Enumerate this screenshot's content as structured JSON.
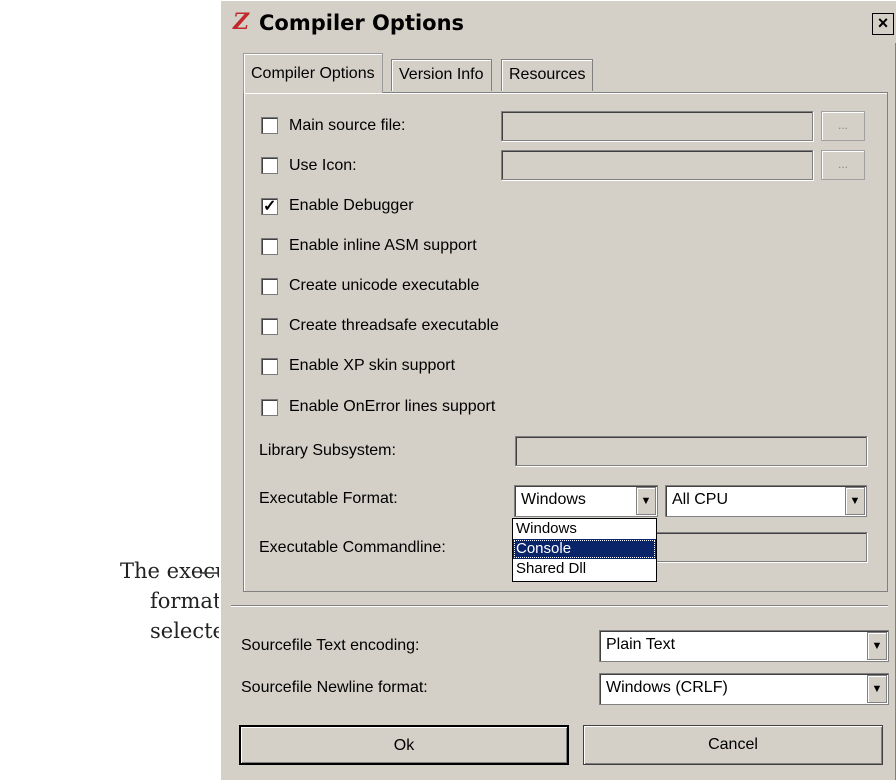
{
  "callout": {
    "lines": [
      "The executable",
      "format is",
      "selected here"
    ]
  },
  "window": {
    "title": "Compiler Options",
    "icon": "app-logo-icon",
    "close_label": "×"
  },
  "tabs": [
    {
      "label": "Compiler Options",
      "active": true
    },
    {
      "label": "Version Info",
      "active": false
    },
    {
      "label": "Resources",
      "active": false
    }
  ],
  "options": {
    "main_source": {
      "label": "Main source file:",
      "checked": false,
      "value": "",
      "browse_label": "..."
    },
    "use_icon": {
      "label": "Use Icon:",
      "checked": false,
      "value": "",
      "browse_label": "..."
    },
    "checkboxes": [
      {
        "label": "Enable Debugger",
        "checked": true
      },
      {
        "label": "Enable inline ASM support",
        "checked": false
      },
      {
        "label": "Create unicode executable",
        "checked": false
      },
      {
        "label": "Create threadsafe executable",
        "checked": false
      },
      {
        "label": "Enable XP skin support",
        "checked": false
      },
      {
        "label": "Enable OnError lines support",
        "checked": false
      }
    ],
    "library_subsystem": {
      "label": "Library Subsystem:",
      "value": ""
    },
    "executable_format": {
      "label": "Executable Format:",
      "selected": "Windows",
      "cpu_selected": "All CPU",
      "dropdown_options": [
        "Windows",
        "Console",
        "Shared Dll"
      ],
      "highlighted": "Console"
    },
    "executable_commandline": {
      "label": "Executable Commandline:",
      "value": ""
    }
  },
  "encoding": {
    "text_label": "Sourcefile Text encoding:",
    "text_value": "Plain Text",
    "newline_label": "Sourcefile Newline format:",
    "newline_value": "Windows (CRLF)"
  },
  "buttons": {
    "ok": "Ok",
    "cancel": "Cancel"
  },
  "colors": {
    "dialog_bg": "#d4d0c8",
    "selection": "#0a246a",
    "title_icon": "#c0282c"
  }
}
